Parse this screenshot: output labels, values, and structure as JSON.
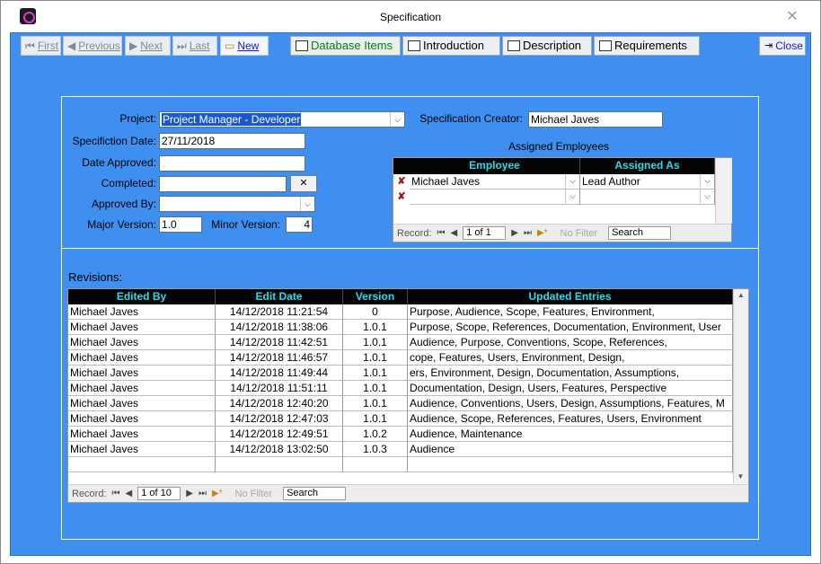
{
  "window": {
    "title": "Specification",
    "close_glyph": "✕"
  },
  "toolbar": {
    "first": "First",
    "previous": "Previous",
    "next": "Next",
    "last": "Last",
    "new": "New",
    "tabs": [
      "Database Items",
      "Introduction",
      "Description",
      "Requirements"
    ],
    "close": "Close"
  },
  "details": {
    "project_label": "Project:",
    "project_value": "Project Manager - Developer",
    "spec_date_label": "Specifiction Date:",
    "spec_date_value": "27/11/2018",
    "date_approved_label": "Date Approved:",
    "date_approved_value": "",
    "completed_label": "Completed:",
    "completed_value": "",
    "clear_button": "✕",
    "approved_by_label": "Approved By:",
    "approved_by_value": "",
    "major_version_label": "Major Version:",
    "major_version_value": "1.0",
    "minor_version_label": "Minor Version:",
    "minor_version_value": "4",
    "creator_label": "Specification Creator:",
    "creator_value": "Michael Javes"
  },
  "employees": {
    "title": "Assigned Employees",
    "columns": [
      "Employee",
      "Assigned As"
    ],
    "rows": [
      {
        "employee": "Michael Javes",
        "assigned_as": "Lead Author"
      },
      {
        "employee": "",
        "assigned_as": ""
      }
    ],
    "nav": {
      "record_label": "Record:",
      "position": "1 of 1",
      "filter": "No Filter",
      "search": "Search"
    }
  },
  "revisions": {
    "title": "Revisions:",
    "columns": [
      "Edited By",
      "Edit Date",
      "Version",
      "Updated Entries"
    ],
    "rows": [
      [
        "Michael Javes",
        "14/12/2018 11:21:54",
        "0",
        "Purpose, Audience, Scope, Features, Environment,"
      ],
      [
        "Michael Javes",
        "14/12/2018 11:38:06",
        "1.0.1",
        "Purpose, Scope, References, Documentation, Environment, User"
      ],
      [
        "Michael Javes",
        "14/12/2018 11:42:51",
        "1.0.1",
        "Audience, Purpose, Conventions, Scope, References,"
      ],
      [
        "Michael Javes",
        "14/12/2018 11:46:57",
        "1.0.1",
        "cope, Features, Users, Environment, Design,"
      ],
      [
        "Michael Javes",
        "14/12/2018 11:49:44",
        "1.0.1",
        "ers, Environment, Design, Documentation, Assumptions,"
      ],
      [
        "Michael Javes",
        "14/12/2018 11:51:11",
        "1.0.1",
        "Documentation, Design, Users, Features, Perspective"
      ],
      [
        "Michael Javes",
        "14/12/2018 12:40:20",
        "1.0.1",
        "Audience, Conventions, Users, Design, Assumptions, Features, M"
      ],
      [
        "Michael Javes",
        "14/12/2018 12:47:03",
        "1.0.1",
        "Audience, Scope, References, Features, Users, Environment"
      ],
      [
        "Michael Javes",
        "14/12/2018 12:49:51",
        "1.0.2",
        "Audience, Maintenance"
      ],
      [
        "Michael Javes",
        "14/12/2018 13:02:50",
        "1.0.3",
        "Audience"
      ]
    ],
    "nav": {
      "record_label": "Record:",
      "position": "1 of 10",
      "filter": "No Filter",
      "search": "Search"
    }
  }
}
